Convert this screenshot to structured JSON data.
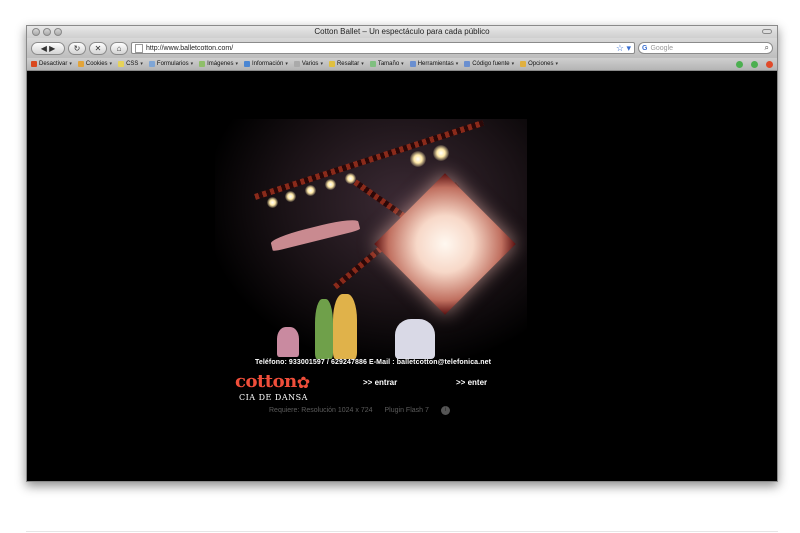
{
  "window": {
    "title": "Cotton Ballet – Un espectáculo para cada público"
  },
  "navbar": {
    "back_icon": "back-arrow-icon",
    "forward_icon": "forward-arrow-icon",
    "reload_glyph": "↻",
    "stop_glyph": "✕",
    "home_glyph": "⌂",
    "url": "http://www.balletcotton.com/",
    "bookmark_glyph": "☆ ▾",
    "search_engine_glyph": "G",
    "search_placeholder": "Google",
    "search_glyph": "⌕"
  },
  "toolbar": {
    "items": [
      {
        "label": "Desactivar",
        "color": "#d9481e"
      },
      {
        "label": "Cookies",
        "color": "#e2a43a"
      },
      {
        "label": "CSS",
        "color": "#e6d35a"
      },
      {
        "label": "Formularios",
        "color": "#7fa6d6"
      },
      {
        "label": "Imágenes",
        "color": "#8fbf6a"
      },
      {
        "label": "Información",
        "color": "#4a86d3"
      },
      {
        "label": "Varios",
        "color": "#aaaaaa"
      },
      {
        "label": "Resaltar",
        "color": "#e0c040"
      },
      {
        "label": "Tamaño",
        "color": "#7fbf7f"
      },
      {
        "label": "Herramientas",
        "color": "#6a8fd0"
      },
      {
        "label": "Código fuente",
        "color": "#6a8fd0"
      },
      {
        "label": "Opciones",
        "color": "#e0b040"
      }
    ],
    "caret": "▾",
    "status_colors": [
      "#4caf50",
      "#4caf50",
      "#e04a2a"
    ]
  },
  "page": {
    "contact": "Teléfono:  933001597  /  629247886  E-Mail :  balletcotton@telefonica.net",
    "logo_word": "cotton",
    "logo_flower": "✿",
    "logo_sub": "CIA DE DANSA",
    "enter_es": ">> entrar",
    "enter_en": ">> enter",
    "requirement": "Requiere: Resolución 1024 x 724",
    "plugin": "Plugin Flash 7",
    "plugin_info": "i"
  }
}
